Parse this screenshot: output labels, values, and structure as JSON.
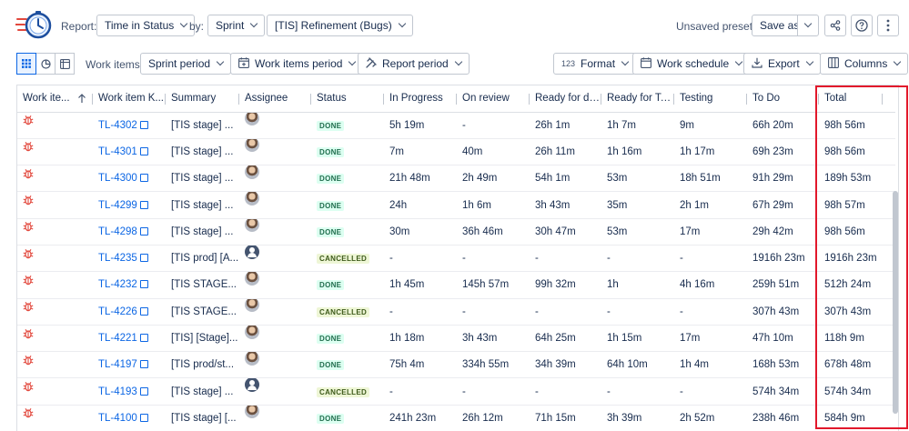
{
  "toolbar": {
    "report_label": "Report:",
    "report_value": "Time in Status",
    "by_label": "by:",
    "by_value": "Sprint",
    "board_value": "[TIS] Refinement (Bugs)",
    "preset_text": "Unsaved preset",
    "save_as_label": "Save as"
  },
  "filters": {
    "work_items_label": "Work items:",
    "sprint_period": "Sprint period",
    "work_items_period": "Work items period",
    "report_period": "Report period",
    "format": "Format",
    "format_prefix": "123",
    "work_schedule": "Work schedule",
    "export": "Export",
    "columns": "Columns"
  },
  "columns": [
    "Work ite...",
    "Work item K...",
    "Summary",
    "Assignee",
    "Status",
    "In Progress",
    "On review",
    "Ready for de...",
    "Ready for Te...",
    "Testing",
    "To Do",
    "Total"
  ],
  "rows": [
    {
      "key": "TL-4302",
      "summary": "[TIS stage] ...",
      "avatar": "photo",
      "status": "DONE",
      "in_progress": "5h 19m",
      "on_review": "-",
      "ready_dev": "26h 1m",
      "ready_test": "1h 7m",
      "testing": "9m",
      "todo": "66h 20m",
      "total": "98h 56m"
    },
    {
      "key": "TL-4301",
      "summary": "[TIS stage] ...",
      "avatar": "photo",
      "status": "DONE",
      "in_progress": "7m",
      "on_review": "40m",
      "ready_dev": "26h 11m",
      "ready_test": "1h 16m",
      "testing": "1h 17m",
      "todo": "69h 23m",
      "total": "98h 56m"
    },
    {
      "key": "TL-4300",
      "summary": "[TIS stage] ...",
      "avatar": "photo",
      "status": "DONE",
      "in_progress": "21h 48m",
      "on_review": "2h 49m",
      "ready_dev": "54h 1m",
      "ready_test": "53m",
      "testing": "18h 51m",
      "todo": "91h 29m",
      "total": "189h 53m"
    },
    {
      "key": "TL-4299",
      "summary": "[TIS stage] ...",
      "avatar": "photo",
      "status": "DONE",
      "in_progress": "24h",
      "on_review": "1h 6m",
      "ready_dev": "3h 43m",
      "ready_test": "35m",
      "testing": "2h 1m",
      "todo": "67h 29m",
      "total": "98h 57m"
    },
    {
      "key": "TL-4298",
      "summary": "[TIS stage] ...",
      "avatar": "photo",
      "status": "DONE",
      "in_progress": "30m",
      "on_review": "36h 46m",
      "ready_dev": "30h 47m",
      "ready_test": "53m",
      "testing": "17m",
      "todo": "29h 42m",
      "total": "98h 56m"
    },
    {
      "key": "TL-4235",
      "summary": "[TIS prod] [A...",
      "avatar": "generic",
      "status": "CANCELLED",
      "in_progress": "-",
      "on_review": "-",
      "ready_dev": "-",
      "ready_test": "-",
      "testing": "-",
      "todo": "1916h 23m",
      "total": "1916h 23m"
    },
    {
      "key": "TL-4232",
      "summary": "[TIS STAGE...",
      "avatar": "photo",
      "status": "DONE",
      "in_progress": "1h 45m",
      "on_review": "145h 57m",
      "ready_dev": "99h 32m",
      "ready_test": "1h",
      "testing": "4h 16m",
      "todo": "259h 51m",
      "total": "512h 24m"
    },
    {
      "key": "TL-4226",
      "summary": "[TIS STAGE...",
      "avatar": "photo",
      "status": "CANCELLED",
      "in_progress": "-",
      "on_review": "-",
      "ready_dev": "-",
      "ready_test": "-",
      "testing": "-",
      "todo": "307h 43m",
      "total": "307h 43m"
    },
    {
      "key": "TL-4221",
      "summary": "[TIS] [Stage]...",
      "avatar": "photo",
      "status": "DONE",
      "in_progress": "1h 18m",
      "on_review": "3h 43m",
      "ready_dev": "64h 25m",
      "ready_test": "1h 15m",
      "testing": "17m",
      "todo": "47h 10m",
      "total": "118h 9m"
    },
    {
      "key": "TL-4197",
      "summary": "[TIS prod/st...",
      "avatar": "photo",
      "status": "DONE",
      "in_progress": "75h 4m",
      "on_review": "334h 55m",
      "ready_dev": "34h 39m",
      "ready_test": "64h 10m",
      "testing": "1h 4m",
      "todo": "168h 53m",
      "total": "678h 48m"
    },
    {
      "key": "TL-4193",
      "summary": "[TIS stage] ...",
      "avatar": "generic",
      "status": "CANCELLED",
      "in_progress": "-",
      "on_review": "-",
      "ready_dev": "-",
      "ready_test": "-",
      "testing": "-",
      "todo": "574h 34m",
      "total": "574h 34m"
    },
    {
      "key": "TL-4100",
      "summary": "[TIS stage] [...",
      "avatar": "photo",
      "status": "DONE",
      "in_progress": "241h 23m",
      "on_review": "26h 12m",
      "ready_dev": "71h 15m",
      "ready_test": "3h 39m",
      "testing": "2h 52m",
      "todo": "238h 46m",
      "total": "584h 9m"
    }
  ],
  "colors": {
    "accent": "#0c66e4",
    "highlight": "#e2182b",
    "bug": "#e2483d"
  }
}
